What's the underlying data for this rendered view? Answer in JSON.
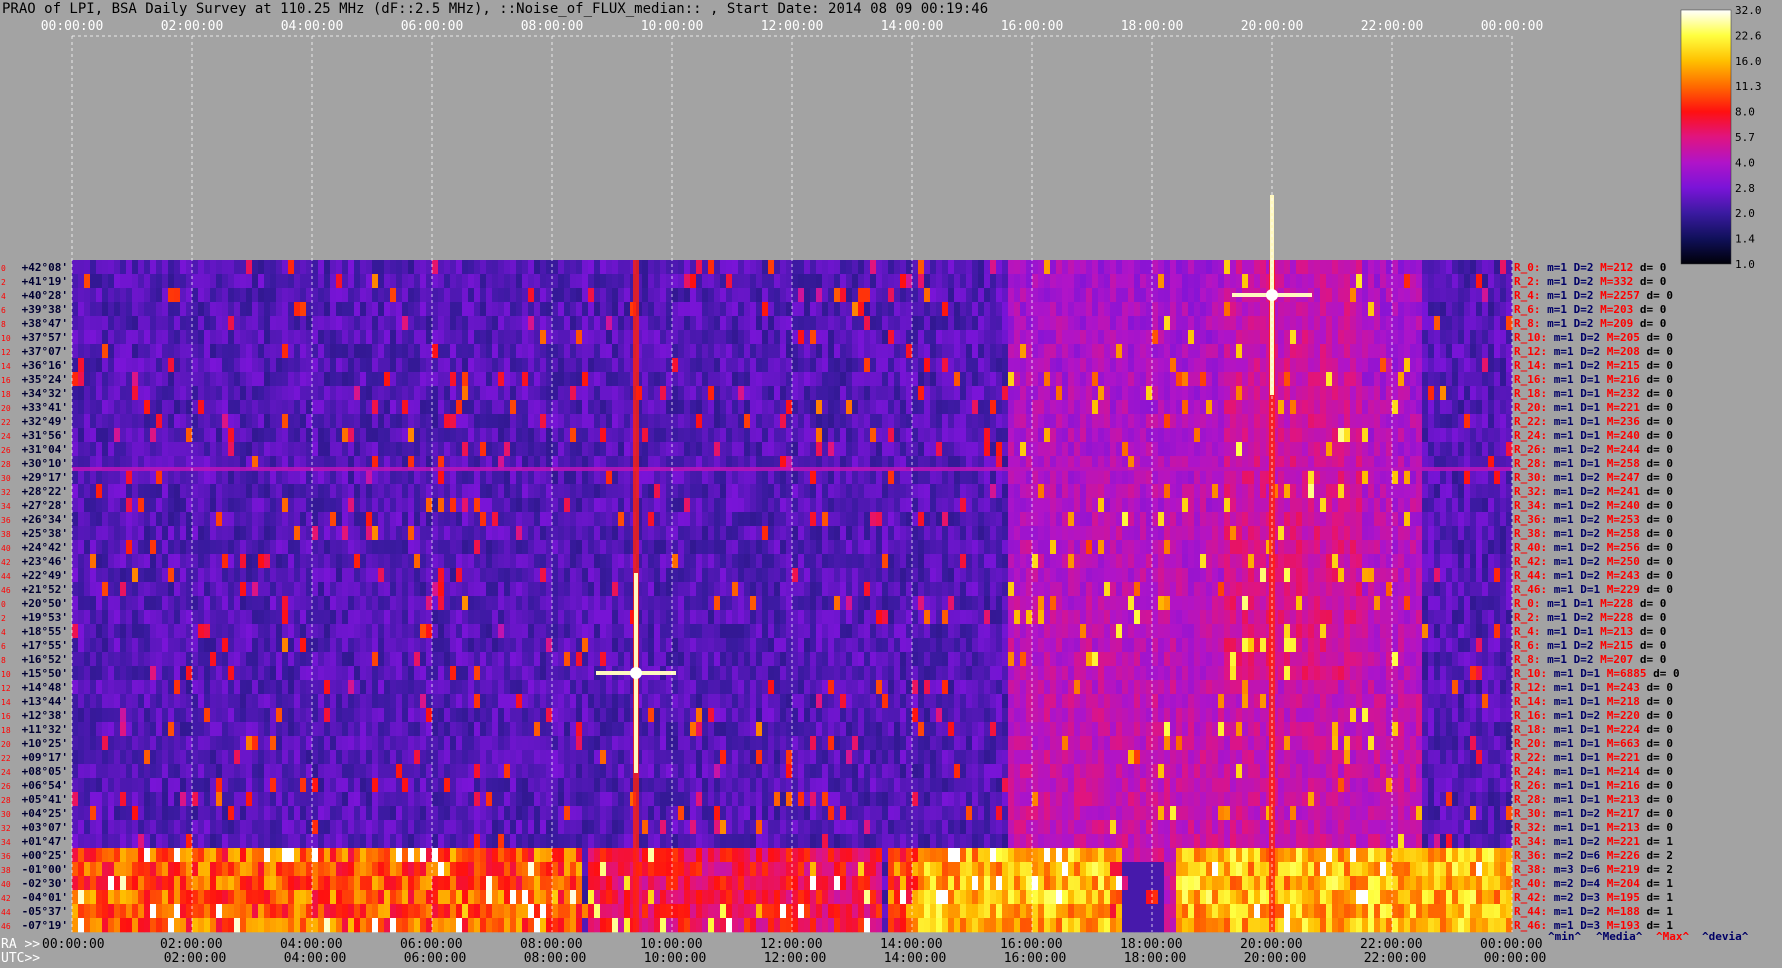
{
  "title": "PRAO of LPI, BSA Daily Survey at 110.25 MHz (dF::2.5 MHz), ::Noise_of_FLUX_median:: , Start Date: 2014 08 09 00:19:46",
  "chart_data": {
    "type": "heatmap",
    "title": "PRAO of LPI, BSA Daily Survey at 110.25 MHz (dF::2.5 MHz), ::Noise_of_FLUX_median:: , Start Date: 2014 08 09 00:19:46",
    "top_axis_ticks": [
      "00:00:00",
      "02:00:00",
      "04:00:00",
      "06:00:00",
      "08:00:00",
      "10:00:00",
      "12:00:00",
      "14:00:00",
      "16:00:00",
      "18:00:00",
      "20:00:00",
      "22:00:00",
      "00:00:00"
    ],
    "ra_axis": {
      "label": "RA >>",
      "ticks": [
        "00:00:00",
        "02:00:00",
        "04:00:00",
        "06:00:00",
        "08:00:00",
        "10:00:00",
        "12:00:00",
        "14:00:00",
        "16:00:00",
        "18:00:00",
        "20:00:00",
        "22:00:00",
        "00:00:00"
      ]
    },
    "utc_axis": {
      "label": "UTC>>",
      "ticks": [
        "02:00:00",
        "04:00:00",
        "06:00:00",
        "08:00:00",
        "10:00:00",
        "12:00:00",
        "14:00:00",
        "16:00:00",
        "18:00:00",
        "20:00:00",
        "22:00:00",
        "00:00:00"
      ]
    },
    "declinations": [
      "+42°08'",
      "+41°19'",
      "+40°28'",
      "+39°38'",
      "+38°47'",
      "+37°57'",
      "+37°07'",
      "+36°16'",
      "+35°24'",
      "+34°32'",
      "+33°41'",
      "+32°49'",
      "+31°56'",
      "+31°04'",
      "+30°10'",
      "+29°17'",
      "+28°22'",
      "+27°28'",
      "+26°34'",
      "+25°38'",
      "+24°42'",
      "+23°46'",
      "+22°49'",
      "+21°52'",
      "+20°50'",
      "+19°53'",
      "+18°55'",
      "+17°55'",
      "+16°52'",
      "+15°50'",
      "+14°48'",
      "+13°44'",
      "+12°38'",
      "+11°32'",
      "+10°25'",
      "+09°17'",
      "+08°05'",
      "+06°54'",
      "+05°41'",
      "+04°25'",
      "+03°07'",
      "+01°47'",
      "+00°25'",
      "-01°00'",
      "-02°30'",
      "-04°01'",
      "-05°37'",
      "-07°19'"
    ],
    "row_numbers": [
      "0",
      "2",
      "4",
      "6",
      "8",
      "10",
      "12",
      "14",
      "16",
      "18",
      "20",
      "22",
      "24",
      "26",
      "28",
      "30",
      "32",
      "34",
      "36",
      "38",
      "40",
      "42",
      "44",
      "46",
      "0",
      "2",
      "4",
      "6",
      "8",
      "10",
      "12",
      "14",
      "16",
      "18",
      "20",
      "22",
      "24",
      "26",
      "28",
      "30",
      "32",
      "34",
      "36",
      "38",
      "40",
      "42",
      "44",
      "46"
    ],
    "row_stats": [
      {
        "label": "R_0:",
        "min": "m=1",
        "med": "D=2",
        "max": "M=212",
        "dev": "d= 0"
      },
      {
        "label": "R_2:",
        "min": "m=1",
        "med": "D=2",
        "max": "M=332",
        "dev": "d= 0"
      },
      {
        "label": "R_4:",
        "min": "m=1",
        "med": "D=2",
        "max": "M=2257",
        "dev": "d= 0"
      },
      {
        "label": "R_6:",
        "min": "m=1",
        "med": "D=2",
        "max": "M=203",
        "dev": "d= 0"
      },
      {
        "label": "R_8:",
        "min": "m=1",
        "med": "D=2",
        "max": "M=209",
        "dev": "d= 0"
      },
      {
        "label": "R_10:",
        "min": "m=1",
        "med": "D=2",
        "max": "M=205",
        "dev": "d= 0"
      },
      {
        "label": "R_12:",
        "min": "m=1",
        "med": "D=2",
        "max": "M=208",
        "dev": "d= 0"
      },
      {
        "label": "R_14:",
        "min": "m=1",
        "med": "D=2",
        "max": "M=215",
        "dev": "d= 0"
      },
      {
        "label": "R_16:",
        "min": "m=1",
        "med": "D=1",
        "max": "M=216",
        "dev": "d= 0"
      },
      {
        "label": "R_18:",
        "min": "m=1",
        "med": "D=1",
        "max": "M=232",
        "dev": "d= 0"
      },
      {
        "label": "R_20:",
        "min": "m=1",
        "med": "D=1",
        "max": "M=221",
        "dev": "d= 0"
      },
      {
        "label": "R_22:",
        "min": "m=1",
        "med": "D=1",
        "max": "M=236",
        "dev": "d= 0"
      },
      {
        "label": "R_24:",
        "min": "m=1",
        "med": "D=1",
        "max": "M=240",
        "dev": "d= 0"
      },
      {
        "label": "R_26:",
        "min": "m=1",
        "med": "D=2",
        "max": "M=244",
        "dev": "d= 0"
      },
      {
        "label": "R_28:",
        "min": "m=1",
        "med": "D=1",
        "max": "M=258",
        "dev": "d= 0"
      },
      {
        "label": "R_30:",
        "min": "m=1",
        "med": "D=2",
        "max": "M=247",
        "dev": "d= 0"
      },
      {
        "label": "R_32:",
        "min": "m=1",
        "med": "D=2",
        "max": "M=241",
        "dev": "d= 0"
      },
      {
        "label": "R_34:",
        "min": "m=1",
        "med": "D=2",
        "max": "M=240",
        "dev": "d= 0"
      },
      {
        "label": "R_36:",
        "min": "m=1",
        "med": "D=2",
        "max": "M=253",
        "dev": "d= 0"
      },
      {
        "label": "R_38:",
        "min": "m=1",
        "med": "D=2",
        "max": "M=258",
        "dev": "d= 0"
      },
      {
        "label": "R_40:",
        "min": "m=1",
        "med": "D=2",
        "max": "M=256",
        "dev": "d= 0"
      },
      {
        "label": "R_42:",
        "min": "m=1",
        "med": "D=2",
        "max": "M=250",
        "dev": "d= 0"
      },
      {
        "label": "R_44:",
        "min": "m=1",
        "med": "D=2",
        "max": "M=243",
        "dev": "d= 0"
      },
      {
        "label": "R_46:",
        "min": "m=1",
        "med": "D=1",
        "max": "M=229",
        "dev": "d= 0"
      },
      {
        "label": "R_0:",
        "min": "m=1",
        "med": "D=1",
        "max": "M=228",
        "dev": "d= 0"
      },
      {
        "label": "R_2:",
        "min": "m=1",
        "med": "D=2",
        "max": "M=228",
        "dev": "d= 0"
      },
      {
        "label": "R_4:",
        "min": "m=1",
        "med": "D=1",
        "max": "M=213",
        "dev": "d= 0"
      },
      {
        "label": "R_6:",
        "min": "m=1",
        "med": "D=2",
        "max": "M=215",
        "dev": "d= 0"
      },
      {
        "label": "R_8:",
        "min": "m=1",
        "med": "D=2",
        "max": "M=207",
        "dev": "d= 0"
      },
      {
        "label": "R_10:",
        "min": "m=1",
        "med": "D=1",
        "max": "M=6885",
        "dev": "d= 0"
      },
      {
        "label": "R_12:",
        "min": "m=1",
        "med": "D=1",
        "max": "M=243",
        "dev": "d= 0"
      },
      {
        "label": "R_14:",
        "min": "m=1",
        "med": "D=1",
        "max": "M=218",
        "dev": "d= 0"
      },
      {
        "label": "R_16:",
        "min": "m=1",
        "med": "D=2",
        "max": "M=220",
        "dev": "d= 0"
      },
      {
        "label": "R_18:",
        "min": "m=1",
        "med": "D=1",
        "max": "M=224",
        "dev": "d= 0"
      },
      {
        "label": "R_20:",
        "min": "m=1",
        "med": "D=1",
        "max": "M=663",
        "dev": "d= 0"
      },
      {
        "label": "R_22:",
        "min": "m=1",
        "med": "D=1",
        "max": "M=221",
        "dev": "d= 0"
      },
      {
        "label": "R_24:",
        "min": "m=1",
        "med": "D=1",
        "max": "M=214",
        "dev": "d= 0"
      },
      {
        "label": "R_26:",
        "min": "m=1",
        "med": "D=1",
        "max": "M=216",
        "dev": "d= 0"
      },
      {
        "label": "R_28:",
        "min": "m=1",
        "med": "D=1",
        "max": "M=213",
        "dev": "d= 0"
      },
      {
        "label": "R_30:",
        "min": "m=1",
        "med": "D=2",
        "max": "M=217",
        "dev": "d= 0"
      },
      {
        "label": "R_32:",
        "min": "m=1",
        "med": "D=1",
        "max": "M=213",
        "dev": "d= 0"
      },
      {
        "label": "R_34:",
        "min": "m=1",
        "med": "D=2",
        "max": "M=221",
        "dev": "d= 1"
      },
      {
        "label": "R_36:",
        "min": "m=2",
        "med": "D=6",
        "max": "M=226",
        "dev": "d= 2"
      },
      {
        "label": "R_38:",
        "min": "m=3",
        "med": "D=6",
        "max": "M=219",
        "dev": "d= 2"
      },
      {
        "label": "R_40:",
        "min": "m=2",
        "med": "D=4",
        "max": "M=204",
        "dev": "d= 1"
      },
      {
        "label": "R_42:",
        "min": "m=2",
        "med": "D=3",
        "max": "M=195",
        "dev": "d= 1"
      },
      {
        "label": "R_44:",
        "min": "m=1",
        "med": "D=2",
        "max": "M=188",
        "dev": "d= 1"
      },
      {
        "label": "R_46:",
        "min": "m=1",
        "med": "D=3",
        "max": "M=193",
        "dev": "d= 1"
      }
    ],
    "stats_legend": [
      "^min^",
      "^Media^",
      "^Max^",
      "^devia^"
    ],
    "colorbar": {
      "ticks": [
        "32.0",
        "22.6",
        "16.0",
        "11.3",
        "8.0",
        "5.7",
        "4.0",
        "2.8",
        "2.0",
        "1.4",
        "1.0"
      ],
      "range": [
        1.0,
        32.0
      ],
      "scale": "log"
    },
    "grid": true,
    "sources": [
      {
        "ra_hours": 9.4,
        "dec": 15.8,
        "name": "",
        "strength": 1.0
      },
      {
        "ra_hours": 20.0,
        "dec": 40.7,
        "name": "",
        "strength": 1.0
      }
    ],
    "colors": {
      "stat_label": "#ff0000",
      "stat_text": "#000066",
      "tick_text": "#000000",
      "row_number": "#ff0000"
    }
  }
}
